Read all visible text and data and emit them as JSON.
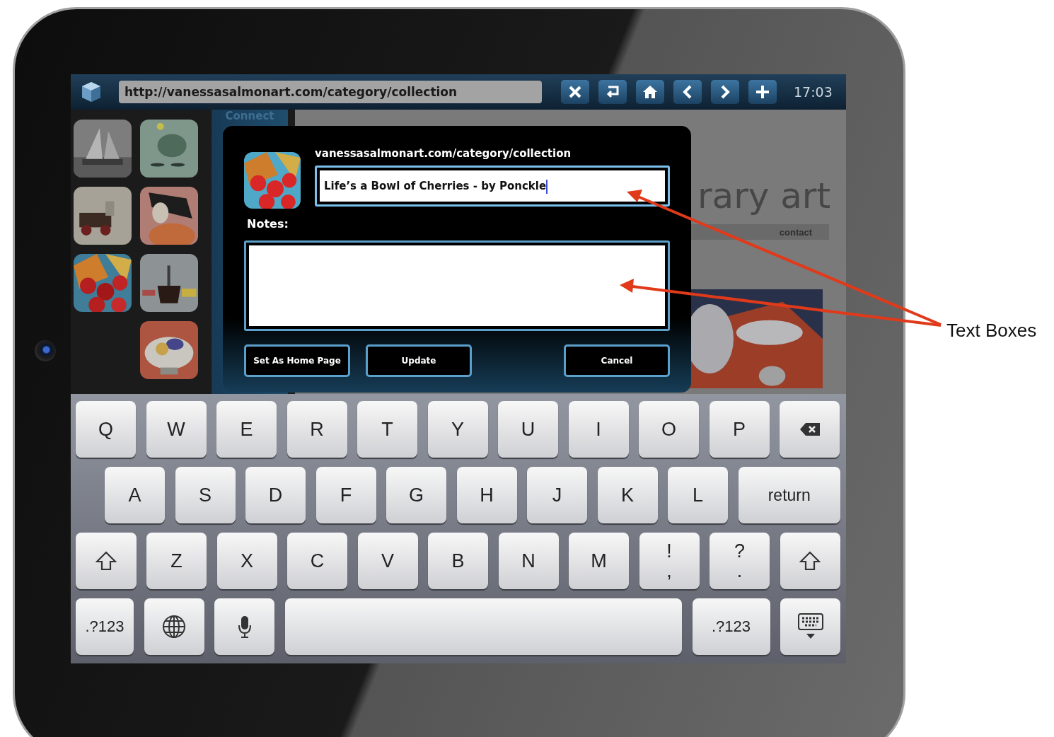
{
  "browser": {
    "url": "http://vanessasalmonart.com/category/collection",
    "time": "17:03"
  },
  "sidebar": {
    "label": "Connect"
  },
  "webpage": {
    "heading": "rary art",
    "nav": [
      "contact"
    ]
  },
  "dialog": {
    "url": "vanessasalmonart.com/category/collection",
    "title_field": {
      "value": "Life’s a Bowl of Cherries - by Ponckle",
      "focused": true
    },
    "notes_label": "Notes:",
    "buttons": [
      "Set As Home Page",
      "Update",
      "Cancel"
    ]
  },
  "keyboard": {
    "rows": [
      {
        "keys": [
          {
            "kind": "char",
            "label": "Q"
          },
          {
            "kind": "char",
            "label": "W"
          },
          {
            "kind": "char",
            "label": "E"
          },
          {
            "kind": "char",
            "label": "R"
          },
          {
            "kind": "char",
            "label": "T"
          },
          {
            "kind": "char",
            "label": "Y"
          },
          {
            "kind": "char",
            "label": "U"
          },
          {
            "kind": "char",
            "label": "I"
          },
          {
            "kind": "char",
            "label": "O"
          },
          {
            "kind": "char",
            "label": "P"
          },
          {
            "kind": "backspace"
          }
        ]
      },
      {
        "keys": [
          {
            "kind": "char",
            "label": "A"
          },
          {
            "kind": "char",
            "label": "S"
          },
          {
            "kind": "char",
            "label": "D"
          },
          {
            "kind": "char",
            "label": "F"
          },
          {
            "kind": "char",
            "label": "G"
          },
          {
            "kind": "char",
            "label": "H"
          },
          {
            "kind": "char",
            "label": "J"
          },
          {
            "kind": "char",
            "label": "K"
          },
          {
            "kind": "char",
            "label": "L"
          },
          {
            "kind": "return",
            "label": "return"
          }
        ]
      },
      {
        "keys": [
          {
            "kind": "shift"
          },
          {
            "kind": "char",
            "label": "Z"
          },
          {
            "kind": "char",
            "label": "X"
          },
          {
            "kind": "char",
            "label": "C"
          },
          {
            "kind": "char",
            "label": "V"
          },
          {
            "kind": "char",
            "label": "B"
          },
          {
            "kind": "char",
            "label": "N"
          },
          {
            "kind": "char",
            "label": "M"
          },
          {
            "kind": "char",
            "label": "!",
            "sub": ","
          },
          {
            "kind": "char",
            "label": "?",
            "sub": "."
          },
          {
            "kind": "shift"
          }
        ]
      },
      {
        "keys": [
          {
            "kind": "numbers",
            "label": ".?123"
          },
          {
            "kind": "globe"
          },
          {
            "kind": "mic"
          },
          {
            "kind": "space"
          },
          {
            "kind": "numbers",
            "label": ".?123"
          },
          {
            "kind": "hide"
          }
        ]
      }
    ]
  },
  "annotation": {
    "label": "Text Boxes"
  }
}
